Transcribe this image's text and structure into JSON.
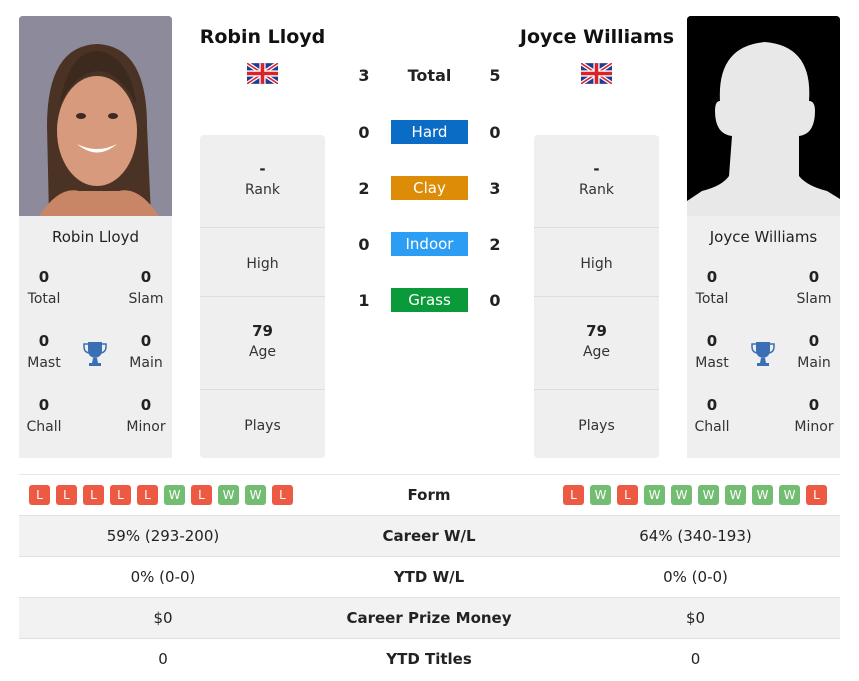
{
  "player1": {
    "name": "Robin Lloyd",
    "country_flag": "uk-flag",
    "titles": {
      "total": {
        "value": "0",
        "label": "Total"
      },
      "slam": {
        "value": "0",
        "label": "Slam"
      },
      "mast": {
        "value": "0",
        "label": "Mast"
      },
      "main": {
        "value": "0",
        "label": "Main"
      },
      "chall": {
        "value": "0",
        "label": "Chall"
      },
      "minor": {
        "value": "0",
        "label": "Minor"
      }
    },
    "rank": {
      "value": "-",
      "label": "Rank"
    },
    "high": {
      "value": "",
      "label": "High"
    },
    "age": {
      "value": "79",
      "label": "Age"
    },
    "plays": {
      "value": "",
      "label": "Plays"
    },
    "form": [
      "L",
      "L",
      "L",
      "L",
      "L",
      "W",
      "L",
      "W",
      "W",
      "L"
    ],
    "career_wl": "59% (293-200)",
    "ytd_wl": "0% (0-0)",
    "prize_money": "$0",
    "ytd_titles": "0"
  },
  "player2": {
    "name": "Joyce Williams",
    "country_flag": "uk-flag",
    "titles": {
      "total": {
        "value": "0",
        "label": "Total"
      },
      "slam": {
        "value": "0",
        "label": "Slam"
      },
      "mast": {
        "value": "0",
        "label": "Mast"
      },
      "main": {
        "value": "0",
        "label": "Main"
      },
      "chall": {
        "value": "0",
        "label": "Chall"
      },
      "minor": {
        "value": "0",
        "label": "Minor"
      }
    },
    "rank": {
      "value": "-",
      "label": "Rank"
    },
    "high": {
      "value": "",
      "label": "High"
    },
    "age": {
      "value": "79",
      "label": "Age"
    },
    "plays": {
      "value": "",
      "label": "Plays"
    },
    "form": [
      "L",
      "W",
      "L",
      "W",
      "W",
      "W",
      "W",
      "W",
      "W",
      "L"
    ],
    "career_wl": "64% (340-193)",
    "ytd_wl": "0% (0-0)",
    "prize_money": "$0",
    "ytd_titles": "0"
  },
  "h2h": {
    "total": {
      "label": "Total",
      "p1": "3",
      "p2": "5"
    },
    "surfaces": [
      {
        "label": "Hard",
        "p1": "0",
        "p2": "0",
        "color": "#0a6cc4"
      },
      {
        "label": "Clay",
        "p1": "2",
        "p2": "3",
        "color": "#dd8c07"
      },
      {
        "label": "Indoor",
        "p1": "0",
        "p2": "2",
        "color": "#2b9ef3"
      },
      {
        "label": "Grass",
        "p1": "1",
        "p2": "0",
        "color": "#0a9a3a"
      }
    ]
  },
  "rows": {
    "form_label": "Form",
    "career_wl_label": "Career W/L",
    "ytd_wl_label": "YTD W/L",
    "prize_label": "Career Prize Money",
    "ytd_titles_label": "YTD Titles"
  }
}
